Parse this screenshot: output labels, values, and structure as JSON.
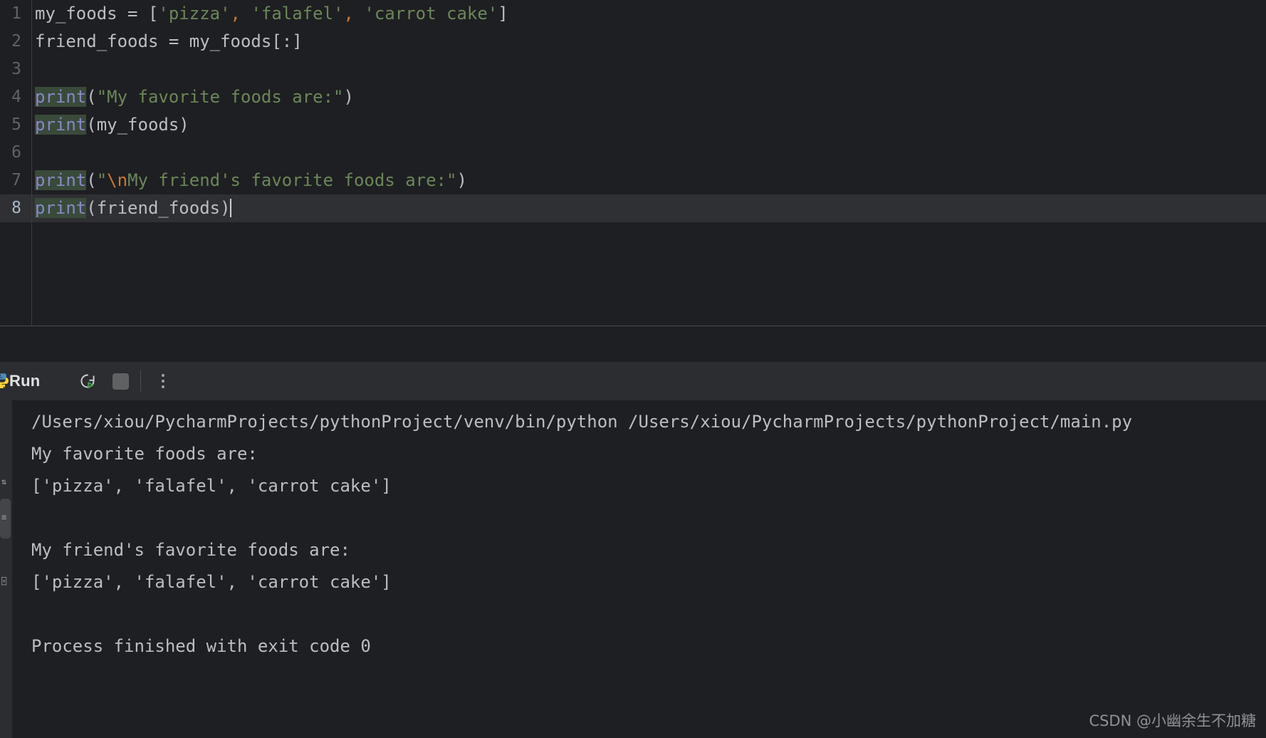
{
  "editor": {
    "gutter_numbers": [
      "1",
      "2",
      "3",
      "4",
      "5",
      "6",
      "7",
      "8"
    ],
    "current_line": 8,
    "lines": [
      {
        "number": "1",
        "plain": "my_foods = ['pizza', 'falafel', 'carrot cake']",
        "tokens": [
          {
            "t": "my_foods = [",
            "c": "plain"
          },
          {
            "t": "'pizza'",
            "c": "str"
          },
          {
            "t": ",",
            "c": "comma"
          },
          {
            "t": " ",
            "c": "plain"
          },
          {
            "t": "'falafel'",
            "c": "str"
          },
          {
            "t": ",",
            "c": "comma"
          },
          {
            "t": " ",
            "c": "plain"
          },
          {
            "t": "'carrot cake'",
            "c": "str"
          },
          {
            "t": "]",
            "c": "plain"
          }
        ]
      },
      {
        "number": "2",
        "plain": "friend_foods = my_foods[:]",
        "tokens": [
          {
            "t": "friend_foods = my_foods[:]",
            "c": "plain"
          }
        ]
      },
      {
        "number": "3",
        "plain": "",
        "tokens": []
      },
      {
        "number": "4",
        "plain": "print(\"My favorite foods are:\")",
        "tokens": [
          {
            "t": "print",
            "c": "kw"
          },
          {
            "t": "(",
            "c": "plain"
          },
          {
            "t": "\"My favorite foods are:\"",
            "c": "str"
          },
          {
            "t": ")",
            "c": "plain"
          }
        ]
      },
      {
        "number": "5",
        "plain": "print(my_foods)",
        "tokens": [
          {
            "t": "print",
            "c": "kw"
          },
          {
            "t": "(my_foods)",
            "c": "plain"
          }
        ]
      },
      {
        "number": "6",
        "plain": "",
        "tokens": []
      },
      {
        "number": "7",
        "plain": "print(\"\\nMy friend's favorite foods are:\")",
        "tokens": [
          {
            "t": "print",
            "c": "kw"
          },
          {
            "t": "(",
            "c": "plain"
          },
          {
            "t": "\"",
            "c": "str"
          },
          {
            "t": "\\n",
            "c": "esc"
          },
          {
            "t": "My friend's favorite foods are:\"",
            "c": "str"
          },
          {
            "t": ")",
            "c": "plain"
          }
        ]
      },
      {
        "number": "8",
        "plain": "print(friend_foods)",
        "tokens": [
          {
            "t": "print",
            "c": "kw"
          },
          {
            "t": "(friend_foods)",
            "c": "plain"
          }
        ]
      }
    ]
  },
  "run_panel": {
    "title": "Run",
    "python_icon": "python-logo-icon",
    "rerun_icon": "rerun-icon",
    "stop_icon": "stop-icon",
    "more_icon": "more-options-icon",
    "console_lines": [
      "/Users/xiou/PycharmProjects/pythonProject/venv/bin/python /Users/xiou/PycharmProjects/pythonProject/main.py",
      "My favorite foods are:",
      "['pizza', 'falafel', 'carrot cake']",
      "",
      "My friend's favorite foods are:",
      "['pizza', 'falafel', 'carrot cake']",
      "",
      "Process finished with exit code 0"
    ]
  },
  "watermark": {
    "text": "CSDN @小幽余生不加糖"
  },
  "colors": {
    "editor_bg": "#1e1f22",
    "panel_bg": "#2b2d30",
    "current_line_bg": "#2f3033",
    "keyword": "#8888c6",
    "keyword_highlight_bg": "#3a4a3a",
    "string": "#6a8759",
    "escape": "#cc7832",
    "text": "#bcbec4",
    "line_number": "#606366",
    "run_green": "#499c54"
  }
}
